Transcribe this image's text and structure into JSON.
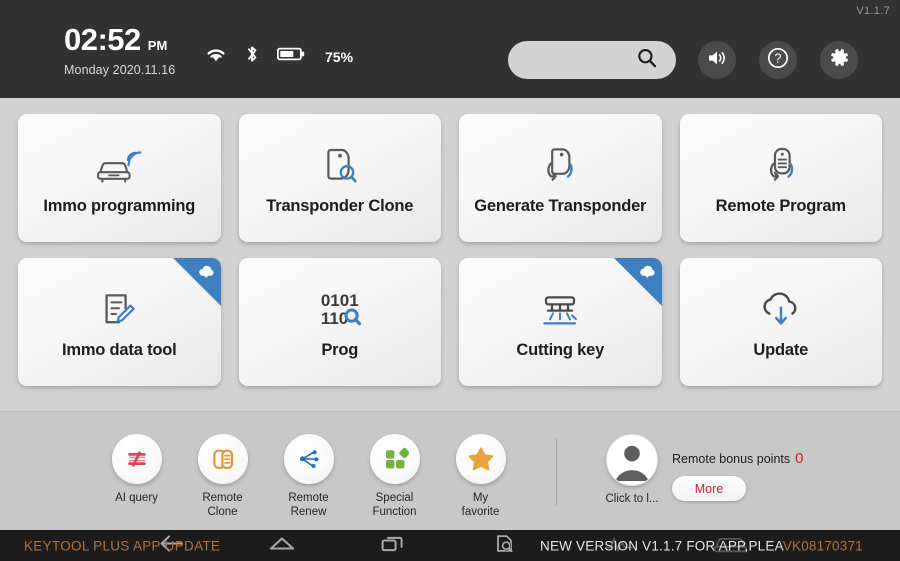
{
  "header": {
    "version": "V1.1.7",
    "time": "02:52",
    "ampm": "PM",
    "date": "Monday 2020.11.16",
    "battery": "75%",
    "wifi_icon": "wifi-icon",
    "bluetooth_icon": "bluetooth-icon",
    "battery_icon": "battery-icon",
    "search": {
      "value": "",
      "placeholder": ""
    },
    "buttons": [
      {
        "name": "volume-icon",
        "label": "Volume"
      },
      {
        "name": "help-icon",
        "label": "Help"
      },
      {
        "name": "settings-icon",
        "label": "Settings"
      }
    ]
  },
  "tiles": [
    {
      "label": "Immo programming",
      "icon": "car-signal-icon",
      "badge": false
    },
    {
      "label": "Transponder Clone",
      "icon": "transponder-search-icon",
      "badge": false
    },
    {
      "label": "Generate Transponder",
      "icon": "transponder-refresh-icon",
      "badge": false
    },
    {
      "label": "Remote Program",
      "icon": "remote-refresh-icon",
      "badge": false
    },
    {
      "label": "Immo data tool",
      "icon": "document-edit-icon",
      "badge": true
    },
    {
      "label": "Prog",
      "icon": "binary-search-icon",
      "badge": false,
      "binary_top": "0101",
      "binary_bottom": "110"
    },
    {
      "label": "Cutting key",
      "icon": "key-cutter-icon",
      "badge": true
    },
    {
      "label": "Update",
      "icon": "cloud-download-icon",
      "badge": false
    }
  ],
  "dock": {
    "shortcuts": [
      {
        "label": "AI query",
        "icon": "ai-query-icon",
        "color": "#d9455f"
      },
      {
        "label": "Remote\nClone",
        "label_line1": "Remote",
        "label_line2": "Clone",
        "icon": "remote-clone-icon",
        "color": "#e2973a"
      },
      {
        "label": "Remote\nRenew",
        "label_line1": "Remote",
        "label_line2": "Renew",
        "icon": "remote-renew-icon",
        "color": "#2b6cb8"
      },
      {
        "label": "Special\nFunction",
        "label_line1": "Special",
        "label_line2": "Function",
        "icon": "special-function-icon",
        "color": "#76b043"
      },
      {
        "label": "My\nfavorite",
        "label_line1": "My",
        "label_line2": "favorite",
        "icon": "star-icon",
        "color": "#e8a33a"
      }
    ],
    "account": {
      "label": "Click to l...",
      "avatar_icon": "user-avatar-icon"
    },
    "bonus": {
      "text": "Remote bonus points",
      "value": "0",
      "more_label": "More"
    }
  },
  "navbar": {
    "marquee_left": "KEYTOOL PLUS APP UPDATE",
    "marquee_right_white": "NEW VERSION V1.1.7 FOR APP,PLEA",
    "marquee_right_orange": "VK08170371",
    "buttons": [
      {
        "name": "back-icon"
      },
      {
        "name": "home-icon"
      },
      {
        "name": "recents-icon"
      },
      {
        "name": "screenshot-icon"
      },
      {
        "name": "waveform-icon"
      },
      {
        "name": "car-icon"
      }
    ]
  },
  "colors": {
    "header_bg": "#323232",
    "body_bg": "#d2d2d2",
    "dock_bg": "#c8c8c8",
    "navbar_bg": "#1c1c1c",
    "badge_blue": "#3d7fc1",
    "accent_red": "#d0202f",
    "marquee_orange": "#b5703a"
  }
}
